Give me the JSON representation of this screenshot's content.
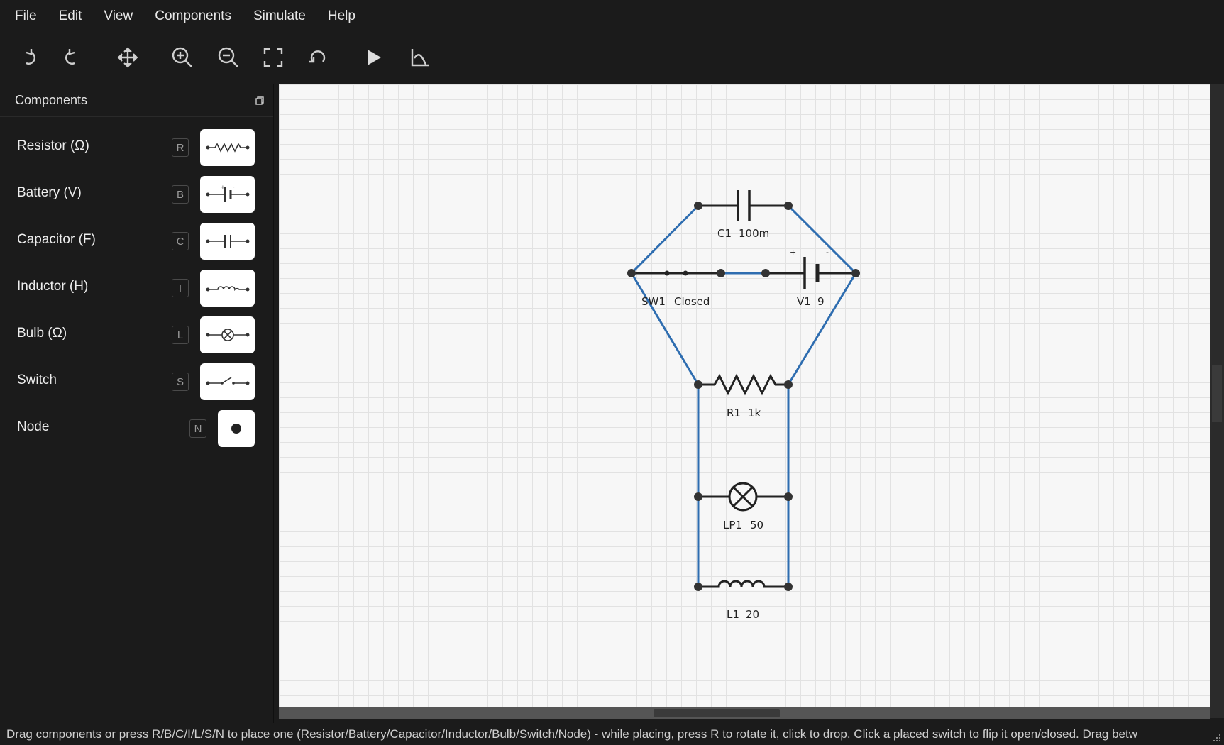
{
  "menu": {
    "items": [
      {
        "label": "File"
      },
      {
        "label": "Edit"
      },
      {
        "label": "View"
      },
      {
        "label": "Components"
      },
      {
        "label": "Simulate"
      },
      {
        "label": "Help"
      }
    ]
  },
  "toolbar": {
    "tools": [
      {
        "icon": "undo-icon"
      },
      {
        "icon": "redo-icon"
      },
      {
        "icon": "pan-move-icon"
      },
      {
        "icon": "zoom-in-icon"
      },
      {
        "icon": "zoom-out-icon"
      },
      {
        "icon": "fit-to-view-icon"
      },
      {
        "icon": "reset-view-icon"
      },
      {
        "icon": "run-simulation-icon"
      },
      {
        "icon": "graph-plot-icon"
      }
    ]
  },
  "sidebar": {
    "title": "Components",
    "items": [
      {
        "label": "Resistor (Ω)",
        "key": "R",
        "icon": "resistor-icon"
      },
      {
        "label": "Battery (V)",
        "key": "B",
        "icon": "battery-icon"
      },
      {
        "label": "Capacitor (F)",
        "key": "C",
        "icon": "capacitor-icon"
      },
      {
        "label": "Inductor (H)",
        "key": "I",
        "icon": "inductor-icon"
      },
      {
        "label": "Bulb (Ω)",
        "key": "L",
        "icon": "bulb-icon"
      },
      {
        "label": "Switch",
        "key": "S",
        "icon": "switch-icon"
      },
      {
        "label": "Node",
        "key": "N",
        "icon": "node-icon"
      }
    ]
  },
  "circuit": {
    "components": [
      {
        "name": "C1",
        "value": "100m"
      },
      {
        "name": "SW1",
        "value": "Closed"
      },
      {
        "name": "V1",
        "value": "9",
        "plus": "+",
        "minus": "-"
      },
      {
        "name": "R1",
        "value": "1k"
      },
      {
        "name": "LP1",
        "value": "50"
      },
      {
        "name": "L1",
        "value": "20"
      }
    ],
    "wire_color": "#2e6db0"
  },
  "status": {
    "text": "Drag components or press R/B/C/I/L/S/N to place one (Resistor/Battery/Capacitor/Inductor/Bulb/Switch/Node) - while placing, press R to rotate it, click to drop. Click a placed switch to flip it open/closed. Drag betw"
  },
  "colors": {
    "background": "#1b1b1b",
    "canvas": "#f7f7f7",
    "wire": "#2e6db0"
  }
}
